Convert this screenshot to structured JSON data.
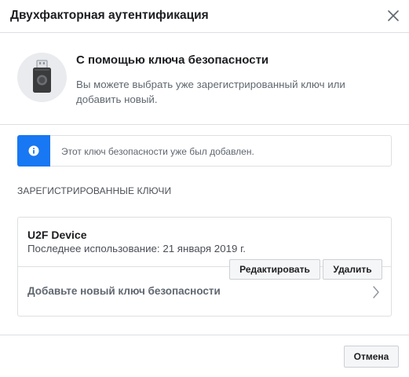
{
  "dialog": {
    "title": "Двухфакторная аутентификация"
  },
  "hero": {
    "title": "С помощью ключа безопасности",
    "description": "Вы можете выбрать уже зарегистрированный ключ или добавить новый."
  },
  "notice": {
    "text": "Этот ключ безопасности уже был добавлен."
  },
  "registered_keys": {
    "section_label": "ЗАРЕГИСТРИРОВАННЫЕ КЛЮЧИ",
    "items": [
      {
        "name": "U2F Device",
        "last_used": "Последнее использование: 21 января 2019 г.",
        "edit_label": "Редактировать",
        "delete_label": "Удалить"
      }
    ],
    "add_label": "Добавьте новый ключ безопасности"
  },
  "footer": {
    "cancel_label": "Отмена"
  },
  "colors": {
    "accent": "#1877f2",
    "border": "#dddfe2",
    "muted_text": "#606770"
  }
}
